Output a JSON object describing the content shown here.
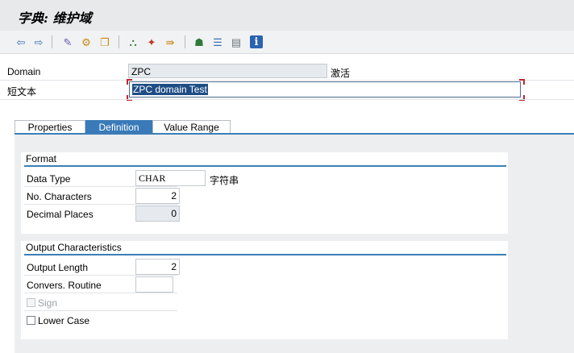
{
  "window": {
    "title": "字典: 维护域"
  },
  "toolbar": {
    "buttons": [
      {
        "name": "back-icon",
        "glyph": "⇦",
        "color": "#3a70b8"
      },
      {
        "name": "forward-icon",
        "glyph": "⇨",
        "color": "#3a70b8"
      },
      {
        "name": "display-change-icon",
        "glyph": "✎",
        "color": "#6a5fb0"
      },
      {
        "name": "activate-icon",
        "glyph": "⚙",
        "color": "#c98a1a"
      },
      {
        "name": "object-list-icon",
        "glyph": "❐",
        "color": "#c98a1a"
      },
      {
        "name": "hierarchy-icon",
        "glyph": "⛬",
        "color": "#2f7a3a"
      },
      {
        "name": "wand-icon",
        "glyph": "✦",
        "color": "#c0392b"
      },
      {
        "name": "where-used-icon",
        "glyph": "⇛",
        "color": "#c98a1a"
      },
      {
        "name": "tree-icon",
        "glyph": "☗",
        "color": "#2f7a3a"
      },
      {
        "name": "stack-icon",
        "glyph": "☰",
        "color": "#3a70b8"
      },
      {
        "name": "list-icon",
        "glyph": "▤",
        "color": "#6b7580"
      },
      {
        "name": "info-icon",
        "glyph": "i",
        "color": "#ffffff"
      }
    ]
  },
  "header": {
    "domain_label": "Domain",
    "domain_value": "ZPC",
    "status": "激活",
    "short_text_label": "短文本",
    "short_text_value": "ZPC domain Test"
  },
  "tabs": [
    {
      "label": "Properties",
      "active": false
    },
    {
      "label": "Definition",
      "active": true
    },
    {
      "label": "Value Range",
      "active": false
    }
  ],
  "format": {
    "title": "Format",
    "data_type_label": "Data Type",
    "data_type_value": "CHAR",
    "data_type_desc": "字符串",
    "no_chars_label": "No. Characters",
    "no_chars_value": "2",
    "decimal_label": "Decimal Places",
    "decimal_value": "0"
  },
  "output": {
    "title": "Output Characteristics",
    "length_label": "Output Length",
    "length_value": "2",
    "conv_label": "Convers. Routine",
    "conv_value": "",
    "sign_label": "Sign",
    "sign_checked": false,
    "lower_label": "Lower Case",
    "lower_checked": false
  },
  "colors": {
    "accent": "#3c7eb5",
    "tab_active": "#3a7ab8",
    "selection": "#1e4d84"
  }
}
